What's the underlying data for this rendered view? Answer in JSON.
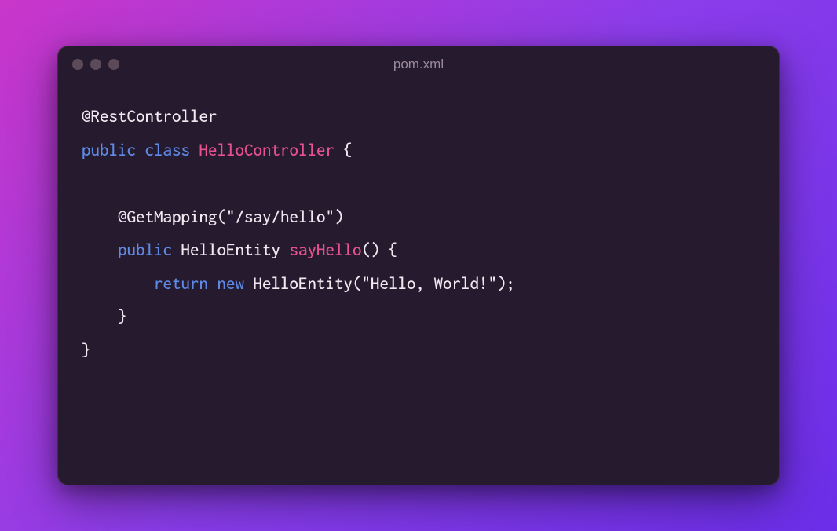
{
  "window": {
    "title": "pom.xml",
    "controls": [
      "close",
      "minimize",
      "zoom"
    ]
  },
  "code": {
    "line1": {
      "annotation_at": "@",
      "annotation_name": "RestController"
    },
    "line2": {
      "kw_public": "public",
      "kw_class": "class",
      "class_name": "HelloController",
      "open_brace": "{"
    },
    "line3": "",
    "line4": {
      "indent": "    ",
      "annotation_at": "@",
      "annotation_name": "GetMapping",
      "open_paren": "(",
      "string": "\"/say/hello\"",
      "close_paren": ")"
    },
    "line5": {
      "indent": "    ",
      "kw_public": "public",
      "return_type": "HelloEntity",
      "method_name": "sayHello",
      "parens": "()",
      "open_brace": "{"
    },
    "line6": {
      "indent": "        ",
      "kw_return": "return",
      "kw_new": "new",
      "ctor_name": "HelloEntity",
      "open_paren": "(",
      "string": "\"Hello, World!\"",
      "close_paren_semi": ");"
    },
    "line7": {
      "indent": "    ",
      "close_brace": "}"
    },
    "line8": {
      "close_brace": "}"
    }
  }
}
